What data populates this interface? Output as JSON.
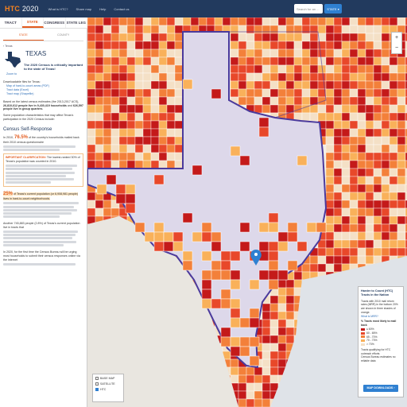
{
  "header": {
    "brand_htc": "HTC",
    "brand_year": "2020",
    "nav": [
      "What is HTC?",
      "Share map",
      "Help",
      "Contact us"
    ],
    "search_placeholder": "Search for an ...",
    "state_button": "STATE ▾"
  },
  "tabs": [
    {
      "label": "TRACT",
      "active": false
    },
    {
      "label": "STATE",
      "active": true
    },
    {
      "label": "CONGRESS",
      "active": false
    },
    {
      "label": "STATE LEG",
      "active": false
    }
  ],
  "panel": {
    "subtabs": [
      "STATE",
      "COUNTY"
    ],
    "breadcrumb": "‹ Texas",
    "state_name": "TEXAS",
    "state_note": "The 2020 Census is critically important to the state of Texas!",
    "zoom_to": "Zoom to",
    "downloads_title": "Downloadable files for Texas:",
    "downloads": [
      "Map of hard-to-count areas (PDF)",
      "Tract data (Excel)",
      "Tract map (Shapefile)"
    ],
    "summary_lead": "Based on the latest census estimates (the 2013-2017 ACS)",
    "summary_people": "26,810,612 people live in 9,430,419 households",
    "summary_gq": "626,597 people live in group quarters",
    "summary_tail": "Some population characteristics that may affect Texas's participation in the 2020 Census include:",
    "self_response_heading": "Census Self-Response",
    "self_response_lead": "In 2010,",
    "self_response_pct": "76.5%",
    "self_response_text": "of the country's households mailed back their 2010 census questionnaire",
    "clarification_title": "IMPORTANT CLARIFICATION:",
    "clarification_text": "The lowest-ranked 30% of Texas's population was counted in 2010.",
    "hard_pct": "25%",
    "hard_text": "of Texas's current population (or 6,908,981 people) lives in hard-to-count neighborhoods.",
    "another_text": "Another 745,883 people (2.8%) of Texas's current population live in tracts that",
    "bottom_text": "In 2020, for the first time the Census Bureau will be urging most households to submit their census responses online via the internet"
  },
  "legend": {
    "title": "Harder to Count (HTC) Tracts in the Nation",
    "body": "Tracts with 2010 mail return rates (MRR) in the bottom 20% are shown in three shades of orange.",
    "what_is": "What is MRR?",
    "sub_title": "% Tracts most likely to mail back",
    "levels": [
      {
        "label": "≤ 60%",
        "color": "#c41a1a"
      },
      {
        "label": "60 - 65%",
        "color": "#e8482a"
      },
      {
        "label": "65 - 70%",
        "color": "#f3803a"
      },
      {
        "label": "70 - 73%",
        "color": "#f9b15a"
      },
      {
        "label": "> 73%",
        "color": "#f4e0c6"
      }
    ],
    "note1": "Tracts qualifying for HTC outreach efforts",
    "note2": "Census Bureau estimates no reliable data",
    "button": "MAP DOWNLOADS ›"
  },
  "layers": [
    "BASE MAP",
    "SATELLITE",
    "HTC"
  ],
  "layers_checked": [
    false,
    false,
    true
  ],
  "colors": {
    "navy": "#223a5e",
    "accent": "#e35b1e",
    "boundary": "#4b3a9c",
    "texas_fill": "#ddd8ea"
  }
}
